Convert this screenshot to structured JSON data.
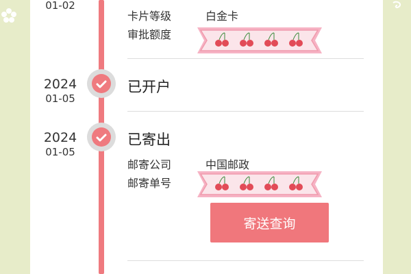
{
  "timeline": [
    {
      "date_md": "01-02",
      "fields": [
        {
          "label": "卡片等级",
          "value": "白金卡"
        },
        {
          "label": "审批额度",
          "value": ""
        }
      ]
    },
    {
      "date_year": "2024",
      "date_md": "01-05",
      "status": "已开户"
    },
    {
      "date_year": "2024",
      "date_md": "01-05",
      "status": "已寄出",
      "fields": [
        {
          "label": "邮寄公司",
          "value": "中国邮政"
        },
        {
          "label": "邮寄单号",
          "value": ""
        }
      ],
      "button_label": "寄送查询"
    }
  ],
  "colors": {
    "accent": "#ef7a7f",
    "button": "#f0777c",
    "background": "#e7ecc9",
    "banner": "#f6b3c4"
  },
  "icons": {
    "node": "check-icon",
    "banner": "cherry-icon",
    "left_deco": "flower-icon"
  }
}
